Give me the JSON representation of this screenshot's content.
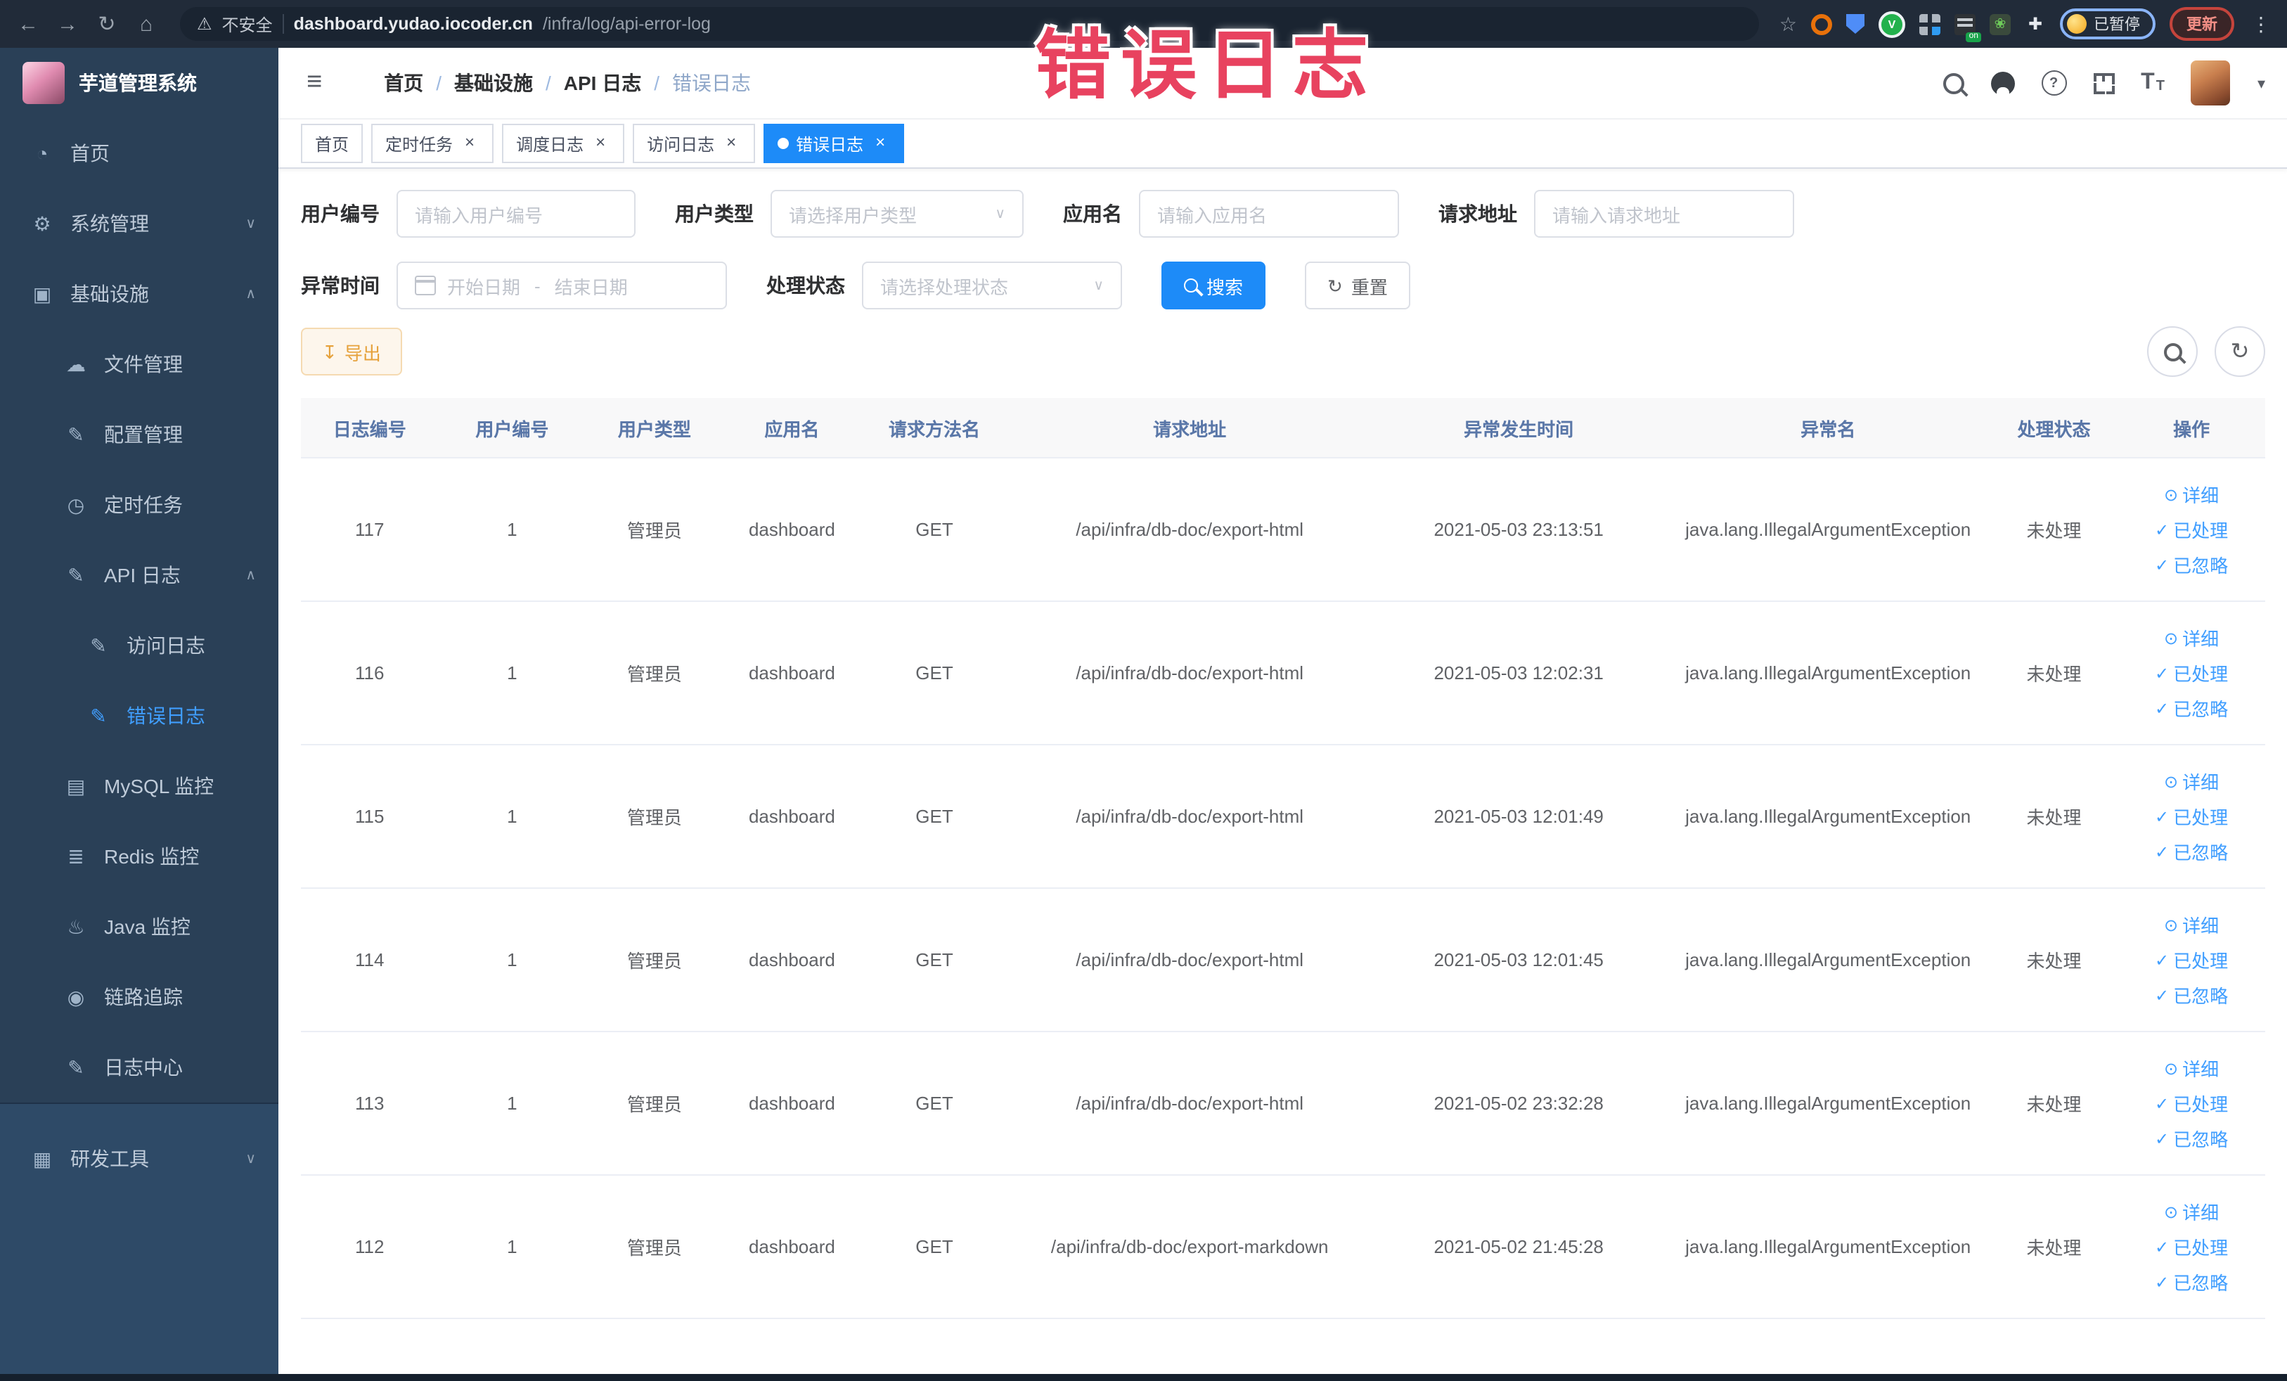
{
  "browser": {
    "security_label": "不安全",
    "url_domain": "dashboard.yudao.iocoder.cn",
    "url_path": "/infra/log/api-error-log",
    "profile_badge": "已暂停",
    "update_button": "更新"
  },
  "overlay": {
    "text": "错误日志",
    "color": "#e8425f"
  },
  "sidebar": {
    "logo_title": "芋道管理系统",
    "items": [
      {
        "label": "首页",
        "icon": "dashboard-icon",
        "level": 0
      },
      {
        "label": "系统管理",
        "icon": "gear-icon",
        "level": 0,
        "chevron_icon": "chevron-down-icon"
      },
      {
        "label": "基础设施",
        "icon": "monitor-icon",
        "level": 0,
        "chevron_icon": "chevron-up-icon"
      },
      {
        "label": "文件管理",
        "icon": "cloud-upload-icon",
        "level": 1
      },
      {
        "label": "配置管理",
        "icon": "edit-icon",
        "level": 1
      },
      {
        "label": "定时任务",
        "icon": "timer-icon",
        "level": 1
      },
      {
        "label": "API 日志",
        "icon": "edit-icon",
        "level": 1,
        "chevron_icon": "chevron-up-icon"
      },
      {
        "label": "访问日志",
        "icon": "edit-icon",
        "level": 2
      },
      {
        "label": "错误日志",
        "icon": "edit-icon",
        "level": 2,
        "active": true
      },
      {
        "label": "MySQL 监控",
        "icon": "mysql-monitor-icon",
        "level": 1
      },
      {
        "label": "Redis 监控",
        "icon": "redis-monitor-icon",
        "level": 1
      },
      {
        "label": "Java 监控",
        "icon": "java-monitor-icon",
        "level": 1
      },
      {
        "label": "链路追踪",
        "icon": "trace-eye-icon",
        "level": 1
      },
      {
        "label": "日志中心",
        "icon": "log-center-icon",
        "level": 1
      }
    ],
    "bottom_item": {
      "label": "研发工具",
      "icon": "briefcase-icon",
      "chevron_icon": "chevron-down-icon"
    }
  },
  "header": {
    "breadcrumb": [
      {
        "label": "首页",
        "sep": "/"
      },
      {
        "label": "基础设施",
        "sep": "/"
      },
      {
        "label": "API 日志",
        "sep": "/"
      },
      {
        "label": "错误日志",
        "current": true
      }
    ]
  },
  "tabs": [
    {
      "label": "首页"
    },
    {
      "label": "定时任务",
      "closable": true
    },
    {
      "label": "调度日志",
      "closable": true
    },
    {
      "label": "访问日志",
      "closable": true
    },
    {
      "label": "错误日志",
      "closable": true,
      "active": true
    }
  ],
  "filters": {
    "user_id": {
      "label": "用户编号",
      "placeholder": "请输入用户编号"
    },
    "user_type": {
      "label": "用户类型",
      "placeholder": "请选择用户类型"
    },
    "app_name": {
      "label": "应用名",
      "placeholder": "请输入应用名"
    },
    "request_url": {
      "label": "请求地址",
      "placeholder": "请输入请求地址"
    },
    "exception_time": {
      "label": "异常时间",
      "start_placeholder": "开始日期",
      "separator": "-",
      "end_placeholder": "结束日期"
    },
    "process_status": {
      "label": "处理状态",
      "placeholder": "请选择处理状态"
    },
    "search_button": "搜索",
    "reset_button": "重置"
  },
  "toolbar": {
    "export_button": "导出"
  },
  "table": {
    "columns": [
      "日志编号",
      "用户编号",
      "用户类型",
      "应用名",
      "请求方法名",
      "请求地址",
      "异常发生时间",
      "异常名",
      "处理状态",
      "操作"
    ],
    "actions": {
      "detail": "详细",
      "processed": "已处理",
      "ignored": "已忽略"
    },
    "rows": [
      {
        "id": "117",
        "user_id": "1",
        "user_type": "管理员",
        "app": "dashboard",
        "method": "GET",
        "url": "/api/infra/db-doc/export-html",
        "time": "2021-05-03 23:13:51",
        "exception": "java.lang.IllegalArgumentException",
        "status": "未处理"
      },
      {
        "id": "116",
        "user_id": "1",
        "user_type": "管理员",
        "app": "dashboard",
        "method": "GET",
        "url": "/api/infra/db-doc/export-html",
        "time": "2021-05-03 12:02:31",
        "exception": "java.lang.IllegalArgumentException",
        "status": "未处理"
      },
      {
        "id": "115",
        "user_id": "1",
        "user_type": "管理员",
        "app": "dashboard",
        "method": "GET",
        "url": "/api/infra/db-doc/export-html",
        "time": "2021-05-03 12:01:49",
        "exception": "java.lang.IllegalArgumentException",
        "status": "未处理"
      },
      {
        "id": "114",
        "user_id": "1",
        "user_type": "管理员",
        "app": "dashboard",
        "method": "GET",
        "url": "/api/infra/db-doc/export-html",
        "time": "2021-05-03 12:01:45",
        "exception": "java.lang.IllegalArgumentException",
        "status": "未处理"
      },
      {
        "id": "113",
        "user_id": "1",
        "user_type": "管理员",
        "app": "dashboard",
        "method": "GET",
        "url": "/api/infra/db-doc/export-html",
        "time": "2021-05-02 23:32:28",
        "exception": "java.lang.IllegalArgumentException",
        "status": "未处理"
      },
      {
        "id": "112",
        "user_id": "1",
        "user_type": "管理员",
        "app": "dashboard",
        "method": "GET",
        "url": "/api/infra/db-doc/export-markdown",
        "time": "2021-05-02 21:45:28",
        "exception": "java.lang.IllegalArgumentException",
        "status": "未处理"
      }
    ]
  },
  "colors": {
    "accent_blue": "#1d8bf8",
    "link_blue": "#409eff",
    "sidebar_bg": "#2a4057",
    "warning_orange": "#e6a23c",
    "overlay_red": "#e8425f",
    "table_header_text": "#5a77a8"
  },
  "icon_glyphs": {
    "back-icon": "←",
    "forward-icon": "→",
    "reload-icon": "↻",
    "home-icon": "⌂",
    "warning-icon": "⚠",
    "bookmark-star-icon": "☆",
    "browser-menu-icon": "⋮",
    "hamburger-icon": "≡",
    "caret-down-icon": "▾",
    "dashboard-icon": "◔",
    "gear-icon": "⚙",
    "monitor-icon": "▣",
    "cloud-upload-icon": "☁",
    "edit-icon": "✎",
    "timer-icon": "◷",
    "mysql-monitor-icon": "▤",
    "redis-monitor-icon": "≣",
    "java-monitor-icon": "♨",
    "trace-eye-icon": "◉",
    "log-center-icon": "✎",
    "briefcase-icon": "▦",
    "chevron-down-icon": "∨",
    "chevron-up-icon": "∧",
    "close-icon": "×",
    "refresh-icon": "↻",
    "download-icon": "↧",
    "eye-icon": "⊙",
    "check-icon": "✓",
    "select-arrow-icon": "∨",
    "question-icon": "?",
    "font-large": "T",
    "font-small": "T"
  }
}
